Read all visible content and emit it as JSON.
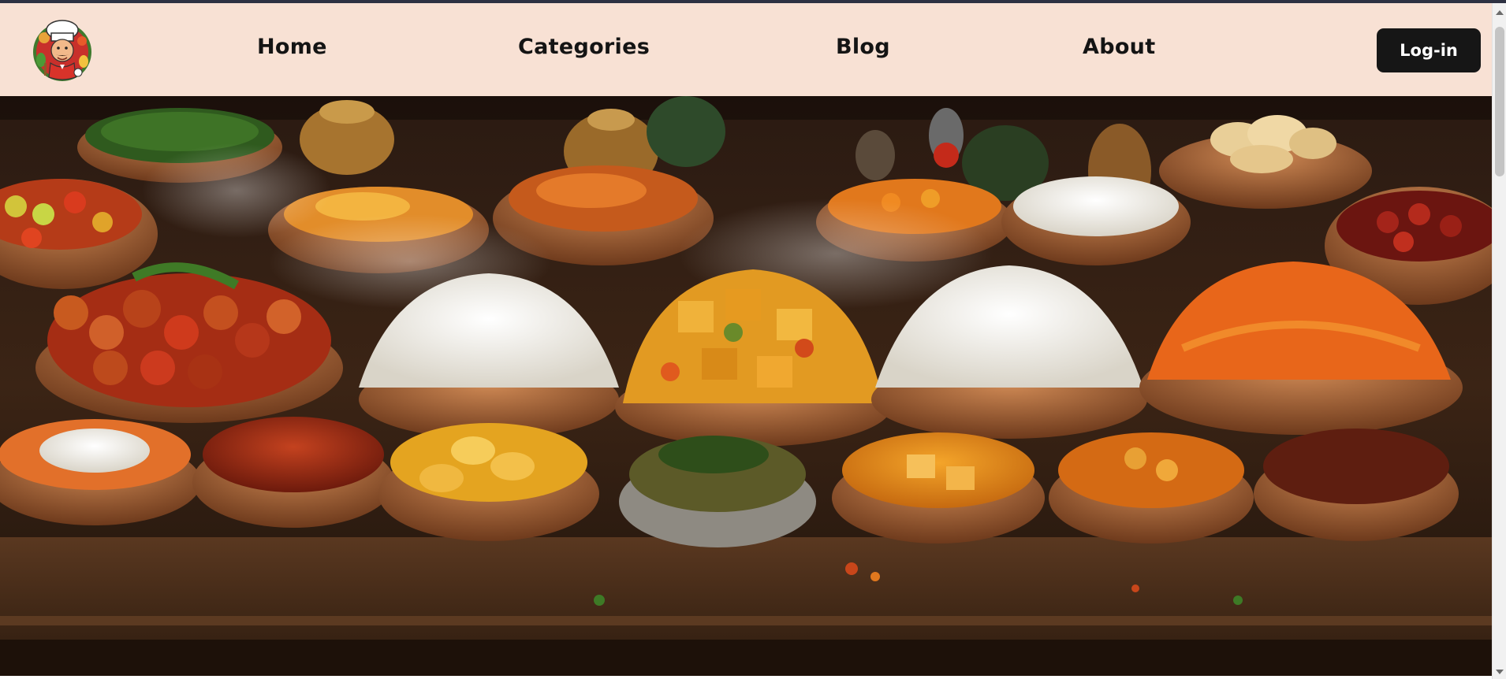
{
  "header": {
    "logo": {
      "icon": "chef-mascot-logo-icon"
    },
    "nav": {
      "home": "Home",
      "categories": "Categories",
      "blog": "Blog",
      "about": "About"
    },
    "login_label": "Log-in"
  },
  "hero": {
    "image": "indian-food-spread-banner-image"
  },
  "colors": {
    "navbar_background": "#f8e1d4",
    "button_background": "#161616",
    "button_text": "#ffffff",
    "nav_text": "#141414"
  }
}
